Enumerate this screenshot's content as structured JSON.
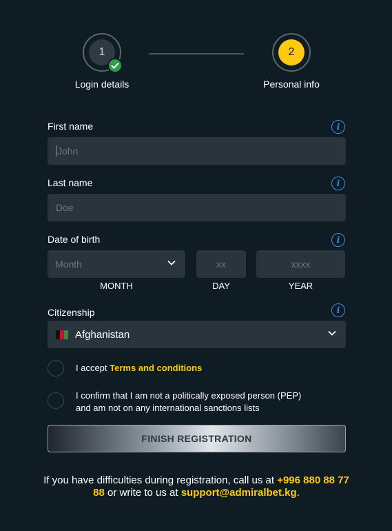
{
  "stepper": {
    "steps": [
      {
        "number": "1",
        "label": "Login details",
        "status": "completed"
      },
      {
        "number": "2",
        "label": "Personal info",
        "status": "active"
      }
    ]
  },
  "form": {
    "first_name": {
      "label": "First name",
      "placeholder": "John",
      "value": ""
    },
    "last_name": {
      "label": "Last name",
      "placeholder": "Doe",
      "value": ""
    },
    "dob": {
      "label": "Date of birth",
      "month_placeholder": "Month",
      "day_placeholder": "xx",
      "year_placeholder": "xxxx",
      "month_label": "MONTH",
      "day_label": "DAY",
      "year_label": "YEAR"
    },
    "citizenship": {
      "label": "Citizenship",
      "value": "Afghanistan"
    },
    "checkbox_terms": {
      "prefix": "I accept ",
      "link": "Terms and conditions",
      "checked": false
    },
    "checkbox_pep": {
      "line1": "I confirm that I am not a politically exposed person (PEP)",
      "line2": "and am not on any international sanctions lists",
      "checked": false
    },
    "submit_label": "FINISH REGISTRATION"
  },
  "footer": {
    "text1": "If you have difficulties during registration, call us at ",
    "phone": "+996 880 88 77 88",
    "text2": " or write to us at ",
    "email": "support@admiralbet.kg",
    "text3": "."
  },
  "colors": {
    "background": "#0f1c23",
    "input": "#2a343c",
    "accent": "#ffc812",
    "info": "#3a8ee6",
    "success": "#2f9e4d"
  },
  "icons": [
    "check-icon",
    "info-icon",
    "chevron-down-icon",
    "afghanistan-flag-icon"
  ]
}
